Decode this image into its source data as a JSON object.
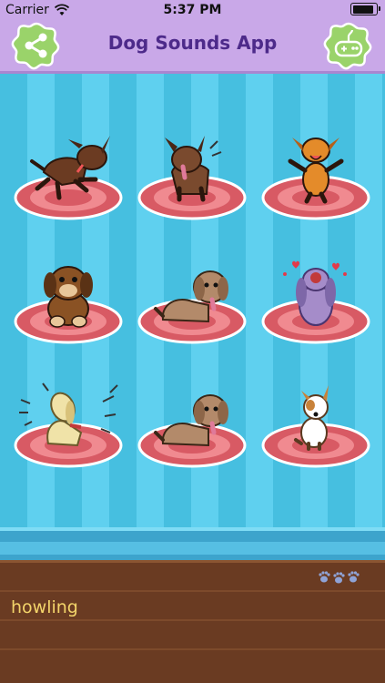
{
  "status_bar": {
    "carrier": "Carrier",
    "time": "5:37 PM"
  },
  "nav": {
    "title": "Dog Sounds App",
    "left_icon": "share-icon",
    "right_icon": "gamepad-icon"
  },
  "grid": [
    {
      "id": "dog-1",
      "color": "#6b3b22"
    },
    {
      "id": "dog-2",
      "color": "#7a4a2e"
    },
    {
      "id": "dog-3",
      "color": "#e48b2a"
    },
    {
      "id": "dog-4",
      "color": "#8a5224"
    },
    {
      "id": "dog-5",
      "color": "#b38a6a"
    },
    {
      "id": "dog-6",
      "color": "#a58cc9"
    },
    {
      "id": "dog-7",
      "color": "#f0e3a8"
    },
    {
      "id": "dog-8",
      "color": "#b38a6a"
    },
    {
      "id": "dog-9",
      "color": "#ffffff"
    }
  ],
  "panel": {
    "sound_text": "howling"
  },
  "colors": {
    "nav_bg": "#c9a8e8",
    "title": "#4d2a8a",
    "button_green": "#9ad36a",
    "plate": "#e8606a",
    "panel_bg": "#6a3b22",
    "label": "#f3d46a"
  }
}
